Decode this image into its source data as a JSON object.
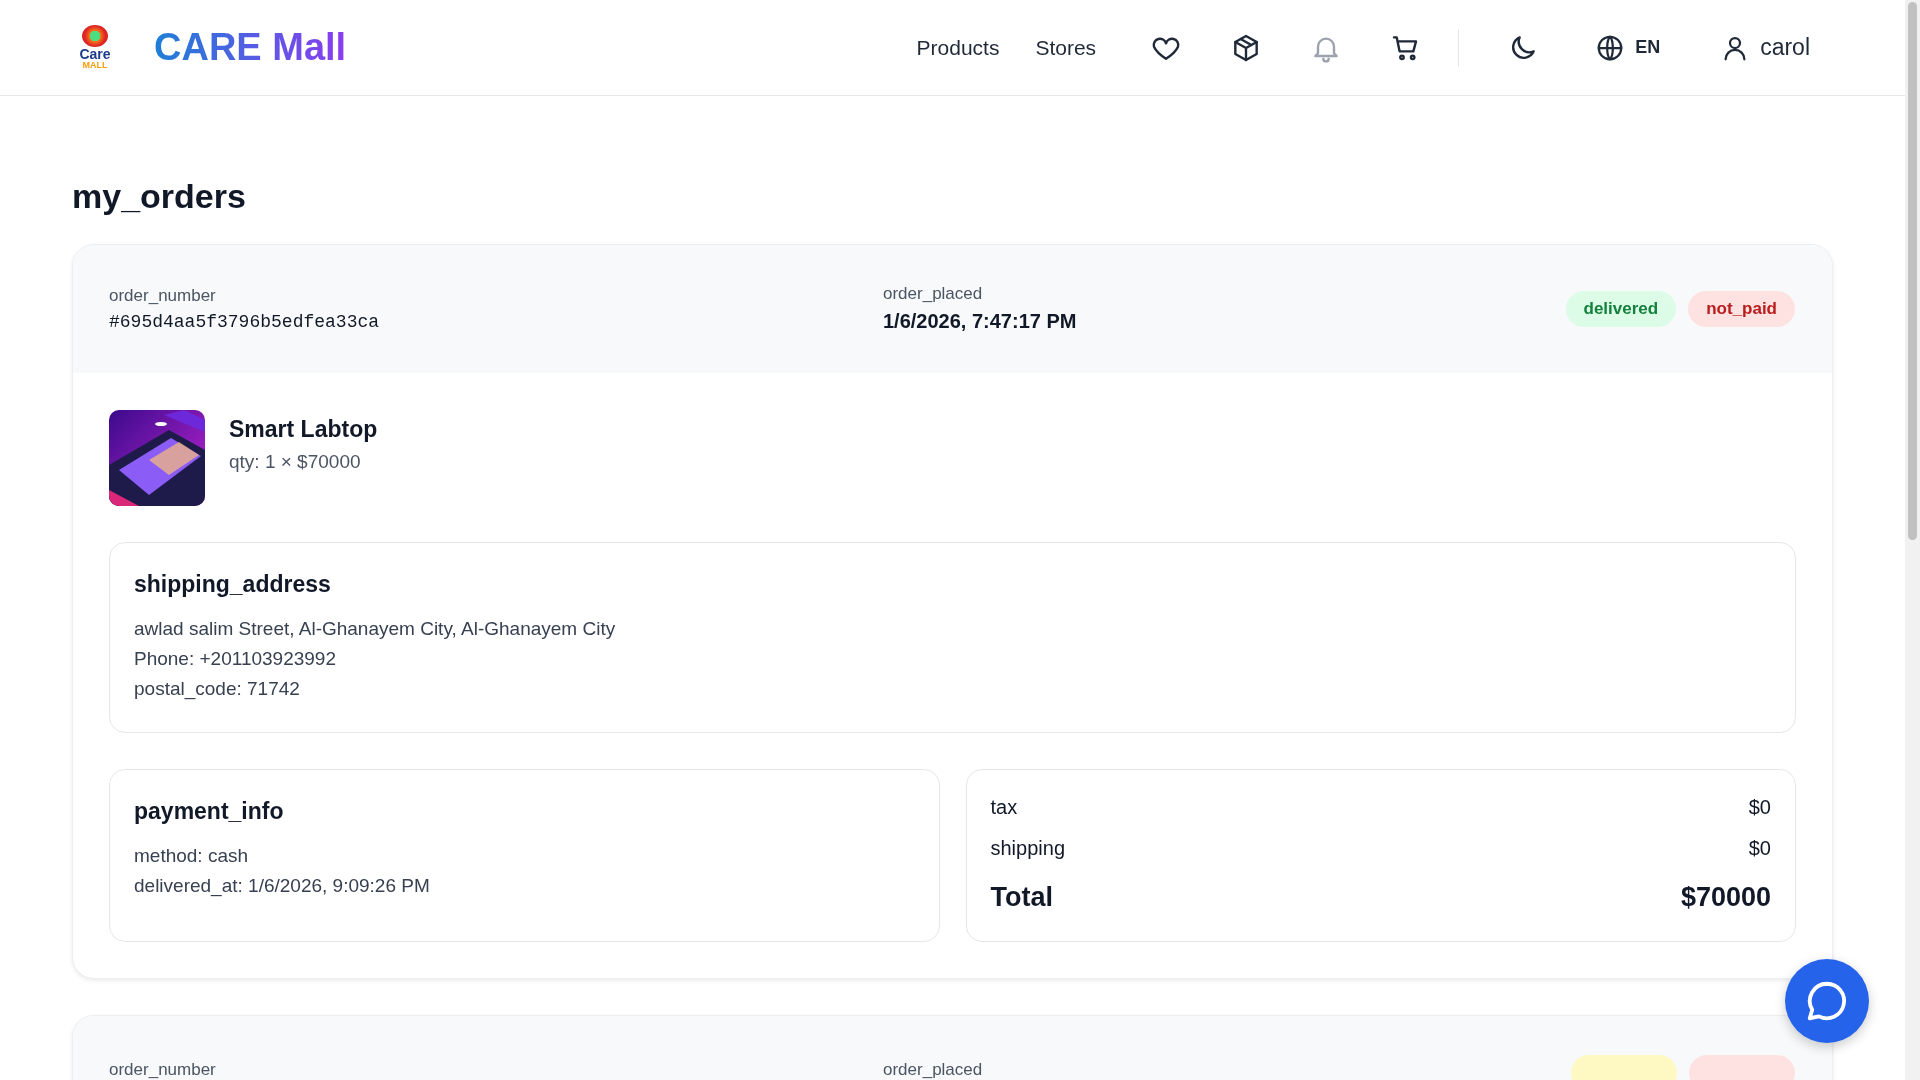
{
  "header": {
    "logo": {
      "text": "Care",
      "subtext": "MALL"
    },
    "brand": "CARE Mall",
    "nav": [
      {
        "label": "Products"
      },
      {
        "label": "Stores"
      }
    ],
    "icons": [
      {
        "kind": "heart"
      },
      {
        "kind": "box"
      },
      {
        "kind": "bell"
      },
      {
        "kind": "cart"
      }
    ],
    "theme_icon": {
      "kind": "moon"
    },
    "language": "EN",
    "user": "carol"
  },
  "page_title": "my_orders",
  "orders": [
    {
      "order_number_label": "order_number",
      "order_number": "#695d4aa5f3796b5edfea33ca",
      "order_placed_label": "order_placed",
      "order_placed": "1/6/2026, 7:47:17 PM",
      "badges": [
        {
          "text": "delivered",
          "kind": "success"
        },
        {
          "text": "not_paid",
          "kind": "danger"
        }
      ],
      "items": [
        {
          "name": "Smart Labtop",
          "qty": "qty: 1 × $70000"
        }
      ],
      "shipping": {
        "title": "shipping_address",
        "lines": [
          "awlad salim Street, Al-Ghanayem City, Al-Ghanayem City",
          "Phone: +201103923992",
          "postal_code: 71742"
        ]
      },
      "payment": {
        "title": "payment_info",
        "lines": [
          "method: cash",
          "delivered_at: 1/6/2026, 9:09:26 PM"
        ]
      },
      "totals": [
        {
          "label": "tax",
          "value": "$0",
          "kind": "line"
        },
        {
          "label": "shipping",
          "value": "$0",
          "kind": "line"
        },
        {
          "label": "Total",
          "value": "$70000",
          "kind": "total"
        }
      ]
    },
    {
      "order_number_label": "order_number",
      "order_placed_label": "order_placed",
      "badges": [
        {
          "kind": "warning"
        },
        {
          "kind": "danger"
        }
      ]
    }
  ]
}
